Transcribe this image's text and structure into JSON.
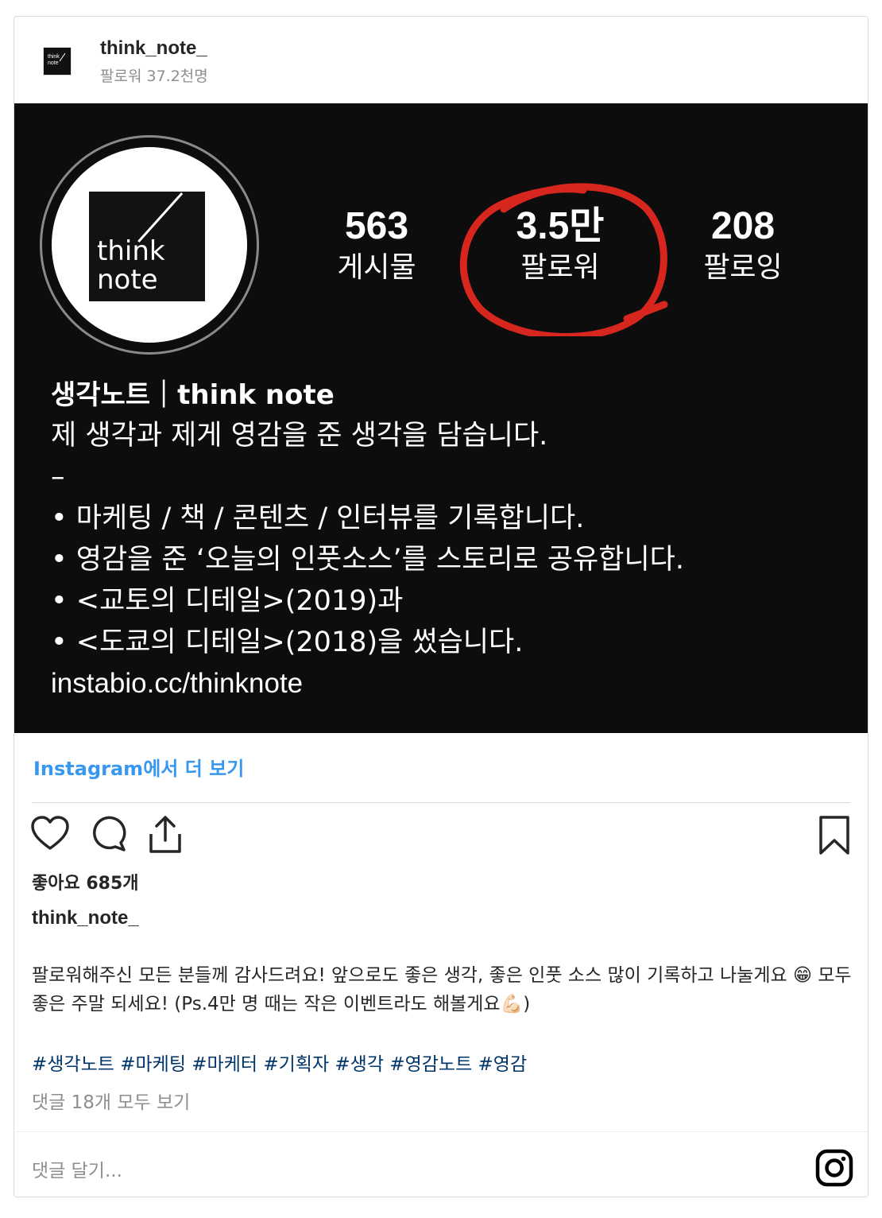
{
  "header": {
    "username": "think_note_",
    "followers_text": "팔로워 37.2천명",
    "avatar_text": "think\nnote"
  },
  "photo": {
    "logo_text_1": "think",
    "logo_text_2": "note",
    "stats": [
      {
        "value": "563",
        "label": "게시물"
      },
      {
        "value": "3.5만",
        "label": "팔로워"
      },
      {
        "value": "208",
        "label": "팔로잉"
      }
    ],
    "highlight_color": "#d7261e",
    "bio_title": "생각노트｜think note",
    "bio_lines": [
      "제 생각과 제게 영감을 준 생각을 담습니다.",
      "–",
      "• 마케팅 / 책 / 콘텐츠 / 인터뷰를 기록합니다.",
      "• 영감을 준 ‘오늘의 인풋소스’를 스토리로 공유합니다.",
      "• <교토의 디테일>(2019)과",
      "• <도쿄의 디테일>(2018)을 썼습니다."
    ],
    "bio_link": "instabio.cc/thinknote"
  },
  "view_more": "Instagram에서 더 보기",
  "actions": {
    "like": "heart-icon",
    "comment": "comment-icon",
    "share": "share-icon",
    "save": "bookmark-icon"
  },
  "likes": "좋아요 685개",
  "owner": "think_note_",
  "caption": "팔로워해주신 모든 분들께 감사드려요! 앞으로도 좋은 생각, 좋은 인풋 소스 많이 기록하고 나눌게요 😁 모두 좋은 주말 되세요! (Ps.4만 명 때는 작은 이벤트라도 해볼게요💪🏻)",
  "hashtags": "#생각노트 #마케팅 #마케터 #기획자 #생각 #영감노트 #영감",
  "view_comments": "댓글 18개 모두 보기",
  "comment_placeholder": "댓글 달기...",
  "colors": {
    "link": "#3897f0",
    "hashtag": "#003569",
    "muted": "#8e8e8e"
  }
}
